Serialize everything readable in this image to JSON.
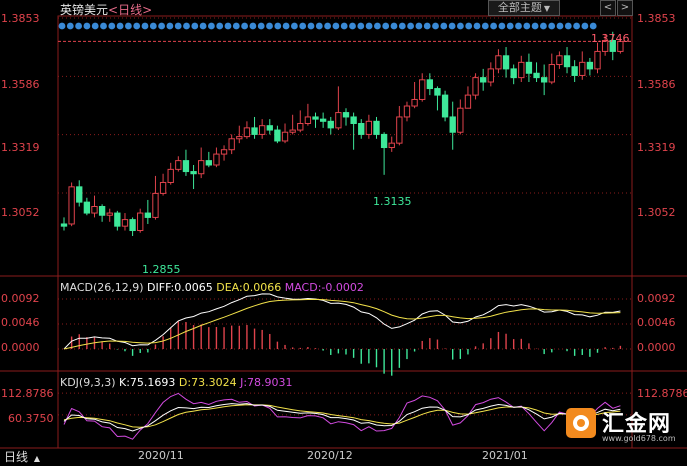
{
  "header": {
    "pair": "英镑美元",
    "period": "<日线>",
    "theme_label": "全部主题",
    "prev": "<",
    "next": ">"
  },
  "right_axis": {
    "top": "1.3853",
    "mid1": "1.3586",
    "mid2": "1.3319",
    "mid3": "1.3052"
  },
  "left_axis": {
    "top": "1.3853",
    "mid1": "1.3586",
    "mid2": "1.3319",
    "mid3": "1.3052"
  },
  "annotations": {
    "high": "1.3746",
    "low1": "1.3135",
    "low2": "1.2855"
  },
  "macd": {
    "title": "MACD(26,12,9)",
    "diff": "DIFF:0.0065",
    "dea": "DEA:0.0066",
    "macd": "MACD:-0.0002",
    "ticks": [
      "0.0092",
      "0.0046",
      "0.0000"
    ]
  },
  "kdj": {
    "title": "KDJ(9,3,3)",
    "k": "K:75.1693",
    "d": "D:73.3024",
    "j": "J:78.9031",
    "ticks": [
      "112.8786",
      "60.3750"
    ]
  },
  "xaxis": [
    "2020/11",
    "2020/12",
    "2021/01"
  ],
  "tab": "日线",
  "logo": {
    "name": "汇金网",
    "url": "www.gold678.com"
  },
  "colors": {
    "up": "#e0434c",
    "down": "#3ee89a",
    "grid": "#8a1c1c",
    "bg": "#000000",
    "dot": "#3a8ad6",
    "diff": "#ffffff",
    "dea": "#f2e24a",
    "j": "#d24be0"
  },
  "chart_data": {
    "type": "candlestick",
    "title": "英镑美元",
    "ylim": [
      1.28,
      1.3853
    ],
    "price_ticks": [
      1.3052,
      1.3319,
      1.3586,
      1.3853
    ],
    "reference_line": 1.3746,
    "candles": [
      [
        1.291,
        1.29,
        1.294,
        1.288
      ],
      [
        1.291,
        1.308,
        1.31,
        1.29
      ],
      [
        1.308,
        1.301,
        1.311,
        1.299
      ],
      [
        1.301,
        1.296,
        1.303,
        1.295
      ],
      [
        1.296,
        1.299,
        1.304,
        1.294
      ],
      [
        1.299,
        1.295,
        1.3,
        1.292
      ],
      [
        1.295,
        1.296,
        1.298,
        1.292
      ],
      [
        1.296,
        1.29,
        1.297,
        1.288
      ],
      [
        1.29,
        1.293,
        1.296,
        1.288
      ],
      [
        1.293,
        1.288,
        1.294,
        1.2855
      ],
      [
        1.288,
        1.296,
        1.298,
        1.287
      ],
      [
        1.296,
        1.294,
        1.302,
        1.291
      ],
      [
        1.294,
        1.305,
        1.313,
        1.293
      ],
      [
        1.305,
        1.31,
        1.314,
        1.304
      ],
      [
        1.31,
        1.316,
        1.319,
        1.309
      ],
      [
        1.316,
        1.32,
        1.322,
        1.315
      ],
      [
        1.32,
        1.315,
        1.325,
        1.313
      ],
      [
        1.315,
        1.314,
        1.318,
        1.307
      ],
      [
        1.314,
        1.32,
        1.326,
        1.312
      ],
      [
        1.32,
        1.318,
        1.324,
        1.317
      ],
      [
        1.318,
        1.323,
        1.326,
        1.317
      ],
      [
        1.323,
        1.325,
        1.327,
        1.32
      ],
      [
        1.325,
        1.33,
        1.332,
        1.323
      ],
      [
        1.33,
        1.331,
        1.336,
        1.328
      ],
      [
        1.331,
        1.335,
        1.338,
        1.33
      ],
      [
        1.335,
        1.332,
        1.34,
        1.33
      ],
      [
        1.332,
        1.336,
        1.339,
        1.33
      ],
      [
        1.336,
        1.334,
        1.339,
        1.332
      ],
      [
        1.334,
        1.329,
        1.336,
        1.328
      ],
      [
        1.329,
        1.333,
        1.337,
        1.328
      ],
      [
        1.333,
        1.334,
        1.341,
        1.332
      ],
      [
        1.334,
        1.337,
        1.343,
        1.333
      ],
      [
        1.337,
        1.34,
        1.346,
        1.336
      ],
      [
        1.34,
        1.339,
        1.342,
        1.335
      ],
      [
        1.339,
        1.338,
        1.342,
        1.335
      ],
      [
        1.338,
        1.335,
        1.34,
        1.332
      ],
      [
        1.335,
        1.342,
        1.354,
        1.334
      ],
      [
        1.342,
        1.34,
        1.344,
        1.336
      ],
      [
        1.34,
        1.337,
        1.342,
        1.325
      ],
      [
        1.337,
        1.332,
        1.339,
        1.33
      ],
      [
        1.332,
        1.338,
        1.341,
        1.33
      ],
      [
        1.338,
        1.332,
        1.34,
        1.33
      ],
      [
        1.332,
        1.326,
        1.333,
        1.3135
      ],
      [
        1.326,
        1.328,
        1.331,
        1.324
      ],
      [
        1.328,
        1.34,
        1.345,
        1.327
      ],
      [
        1.34,
        1.345,
        1.347,
        1.338
      ],
      [
        1.345,
        1.348,
        1.356,
        1.344
      ],
      [
        1.348,
        1.357,
        1.36,
        1.347
      ],
      [
        1.357,
        1.353,
        1.36,
        1.35
      ],
      [
        1.353,
        1.35,
        1.354,
        1.343
      ],
      [
        1.35,
        1.34,
        1.352,
        1.338
      ],
      [
        1.34,
        1.333,
        1.347,
        1.325
      ],
      [
        1.333,
        1.344,
        1.348,
        1.332
      ],
      [
        1.344,
        1.35,
        1.354,
        1.344
      ],
      [
        1.35,
        1.358,
        1.36,
        1.348
      ],
      [
        1.358,
        1.356,
        1.362,
        1.352
      ],
      [
        1.356,
        1.362,
        1.365,
        1.354
      ],
      [
        1.362,
        1.368,
        1.371,
        1.36
      ],
      [
        1.368,
        1.362,
        1.372,
        1.358
      ],
      [
        1.362,
        1.358,
        1.364,
        1.355
      ],
      [
        1.358,
        1.365,
        1.368,
        1.356
      ],
      [
        1.365,
        1.36,
        1.369,
        1.356
      ],
      [
        1.36,
        1.358,
        1.365,
        1.356
      ],
      [
        1.358,
        1.356,
        1.364,
        1.35
      ],
      [
        1.356,
        1.364,
        1.369,
        1.355
      ],
      [
        1.364,
        1.368,
        1.37,
        1.362
      ],
      [
        1.368,
        1.363,
        1.372,
        1.36
      ],
      [
        1.363,
        1.359,
        1.366,
        1.356
      ],
      [
        1.359,
        1.365,
        1.37,
        1.357
      ],
      [
        1.365,
        1.362,
        1.367,
        1.359
      ],
      [
        1.362,
        1.37,
        1.374,
        1.36
      ],
      [
        1.37,
        1.375,
        1.378,
        1.368
      ],
      [
        1.375,
        1.37,
        1.379,
        1.366
      ],
      [
        1.37,
        1.3746,
        1.376,
        1.369
      ]
    ],
    "macd_ylim": [
      -0.0035,
      0.0105
    ],
    "kdj_ylim": [
      -10,
      130
    ]
  }
}
